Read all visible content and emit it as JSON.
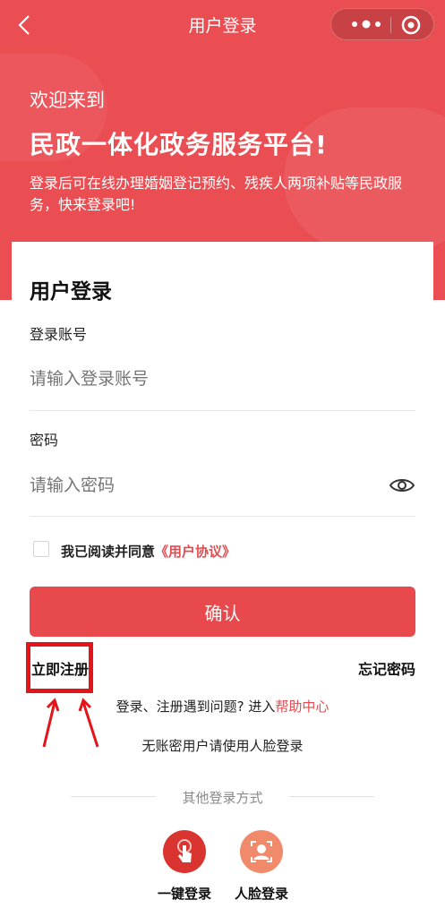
{
  "navbar": {
    "title": "用户登录",
    "back_icon": "chevron-left-icon",
    "more_icon": "more-dots-icon",
    "close_icon": "target-circle-icon"
  },
  "hero": {
    "welcome": "欢迎来到",
    "platform": "民政一体化政务服务平台!",
    "intro": "登录后可在线办理婚姻登记预约、残疾人两项补贴等民政服务，快来登录吧!"
  },
  "login": {
    "title": "用户登录",
    "account_label": "登录账号",
    "account_placeholder": "请输入登录账号",
    "password_label": "密码",
    "password_placeholder": "请输入密码",
    "agree_text": "我已阅读并同意",
    "agreement_link": "《用户协议》",
    "confirm": "确认",
    "register": "立即注册",
    "forgot": "忘记密码",
    "help_prefix": "登录、注册遇到问题? 进入",
    "help_link": "帮助中心",
    "face_tip": "无账密用户请使用人脸登录",
    "other_title": "其他登录方式",
    "options": [
      {
        "label": "一键登录",
        "icon": "tap-hand-icon"
      },
      {
        "label": "人脸登录",
        "icon": "face-scan-icon"
      }
    ]
  },
  "colors": {
    "brand": "#ea4d52",
    "button": "#e8494d",
    "link": "#e34b4f",
    "highlight": "#e3151a",
    "option_one": "#d9342f",
    "option_two": "#f08a6b"
  }
}
